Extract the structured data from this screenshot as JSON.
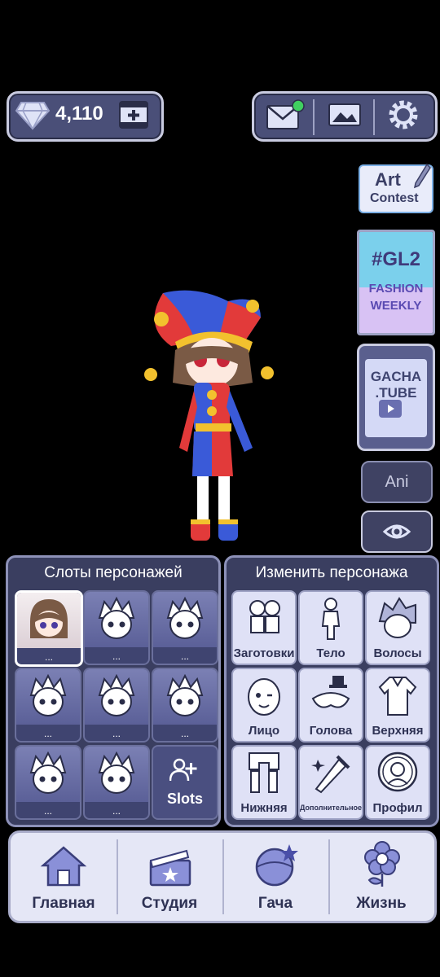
{
  "currency": {
    "gems": "4,110",
    "gem_icon": "diamond-icon",
    "add_icon": "film-plus-icon"
  },
  "top_icons": [
    "mail-icon",
    "gallery-icon",
    "gear-icon"
  ],
  "side": {
    "art_contest": {
      "line1": "Art",
      "line2": "Contest"
    },
    "gl2": {
      "tag": "#GL2",
      "line1": "FASHION",
      "line2": "WEEKLY"
    },
    "gacha_tube": {
      "line1": "GACHA",
      "line2": ".TUBE"
    },
    "ani": "Ani"
  },
  "slots_panel": {
    "title": "Слоты персонажей",
    "slots": [
      "...",
      "...",
      "...",
      "...",
      "...",
      "...",
      "...",
      "..."
    ],
    "add_label": "Slots"
  },
  "edit_panel": {
    "title": "Изменить персонажа",
    "items": [
      "Заготовки",
      "Тело",
      "Волосы",
      "Лицо",
      "Голова",
      "Верхняя",
      "Нижняя",
      "Дополнительное",
      "Профил"
    ]
  },
  "nav": {
    "items": [
      "Главная",
      "Студия",
      "Гача",
      "Жизнь"
    ]
  },
  "colors": {
    "panel": "#3a3e60",
    "tile": "#dfe1f6",
    "accent_green": "#40d060"
  }
}
